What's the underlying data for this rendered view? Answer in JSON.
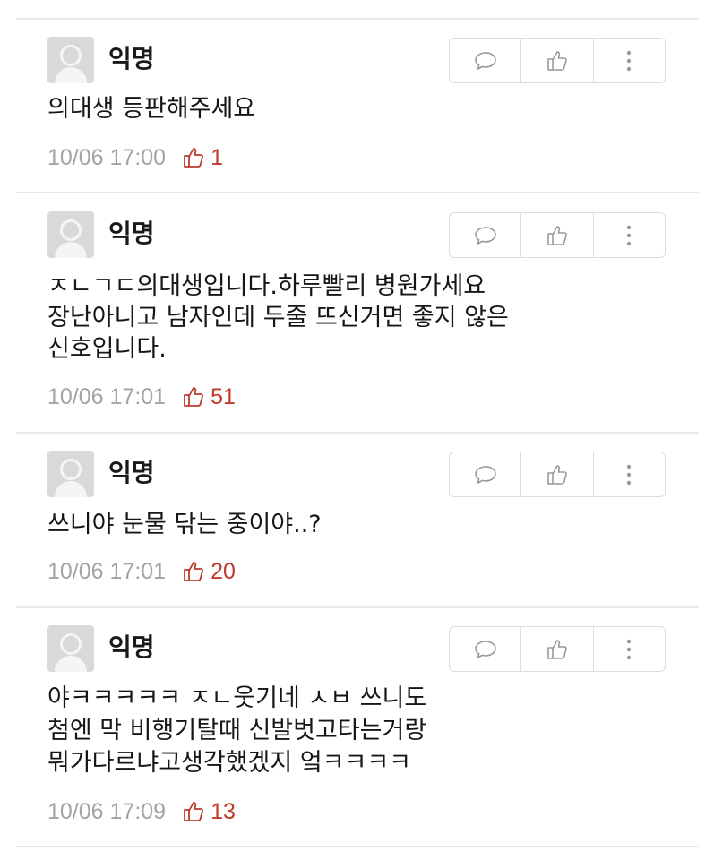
{
  "comments": [
    {
      "author": "익명",
      "text": "의대생 등판해주세요",
      "time": "10/06 17:00",
      "likes": "1"
    },
    {
      "author": "익명",
      "text": "ㅈㄴㄱㄷ의대생입니다.하루빨리 병원가세요\n장난아니고 남자인데 두줄 뜨신거면 좋지 않은\n신호입니다.",
      "time": "10/06 17:01",
      "likes": "51"
    },
    {
      "author": "익명",
      "text": "쓰니야 눈물 닦는 중이야..?",
      "time": "10/06 17:01",
      "likes": "20"
    },
    {
      "author": "익명",
      "text": "야ㅋㅋㅋㅋㅋ ㅈㄴ웃기네 ㅅㅂ 쓰니도\n첨엔 막 비행기탈때 신발벗고타는거랑\n뭐가다르냐고생각했겠지 엌ㅋㅋㅋㅋ",
      "time": "10/06 17:09",
      "likes": "13"
    }
  ],
  "icons": {
    "reply": "speech-bubble-icon",
    "like": "thumbs-up-icon",
    "more": "vertical-dots-icon"
  },
  "colors": {
    "like_count": "#c0392b",
    "timestamp": "#a3a3a3",
    "divider": "#e9e9e9"
  }
}
